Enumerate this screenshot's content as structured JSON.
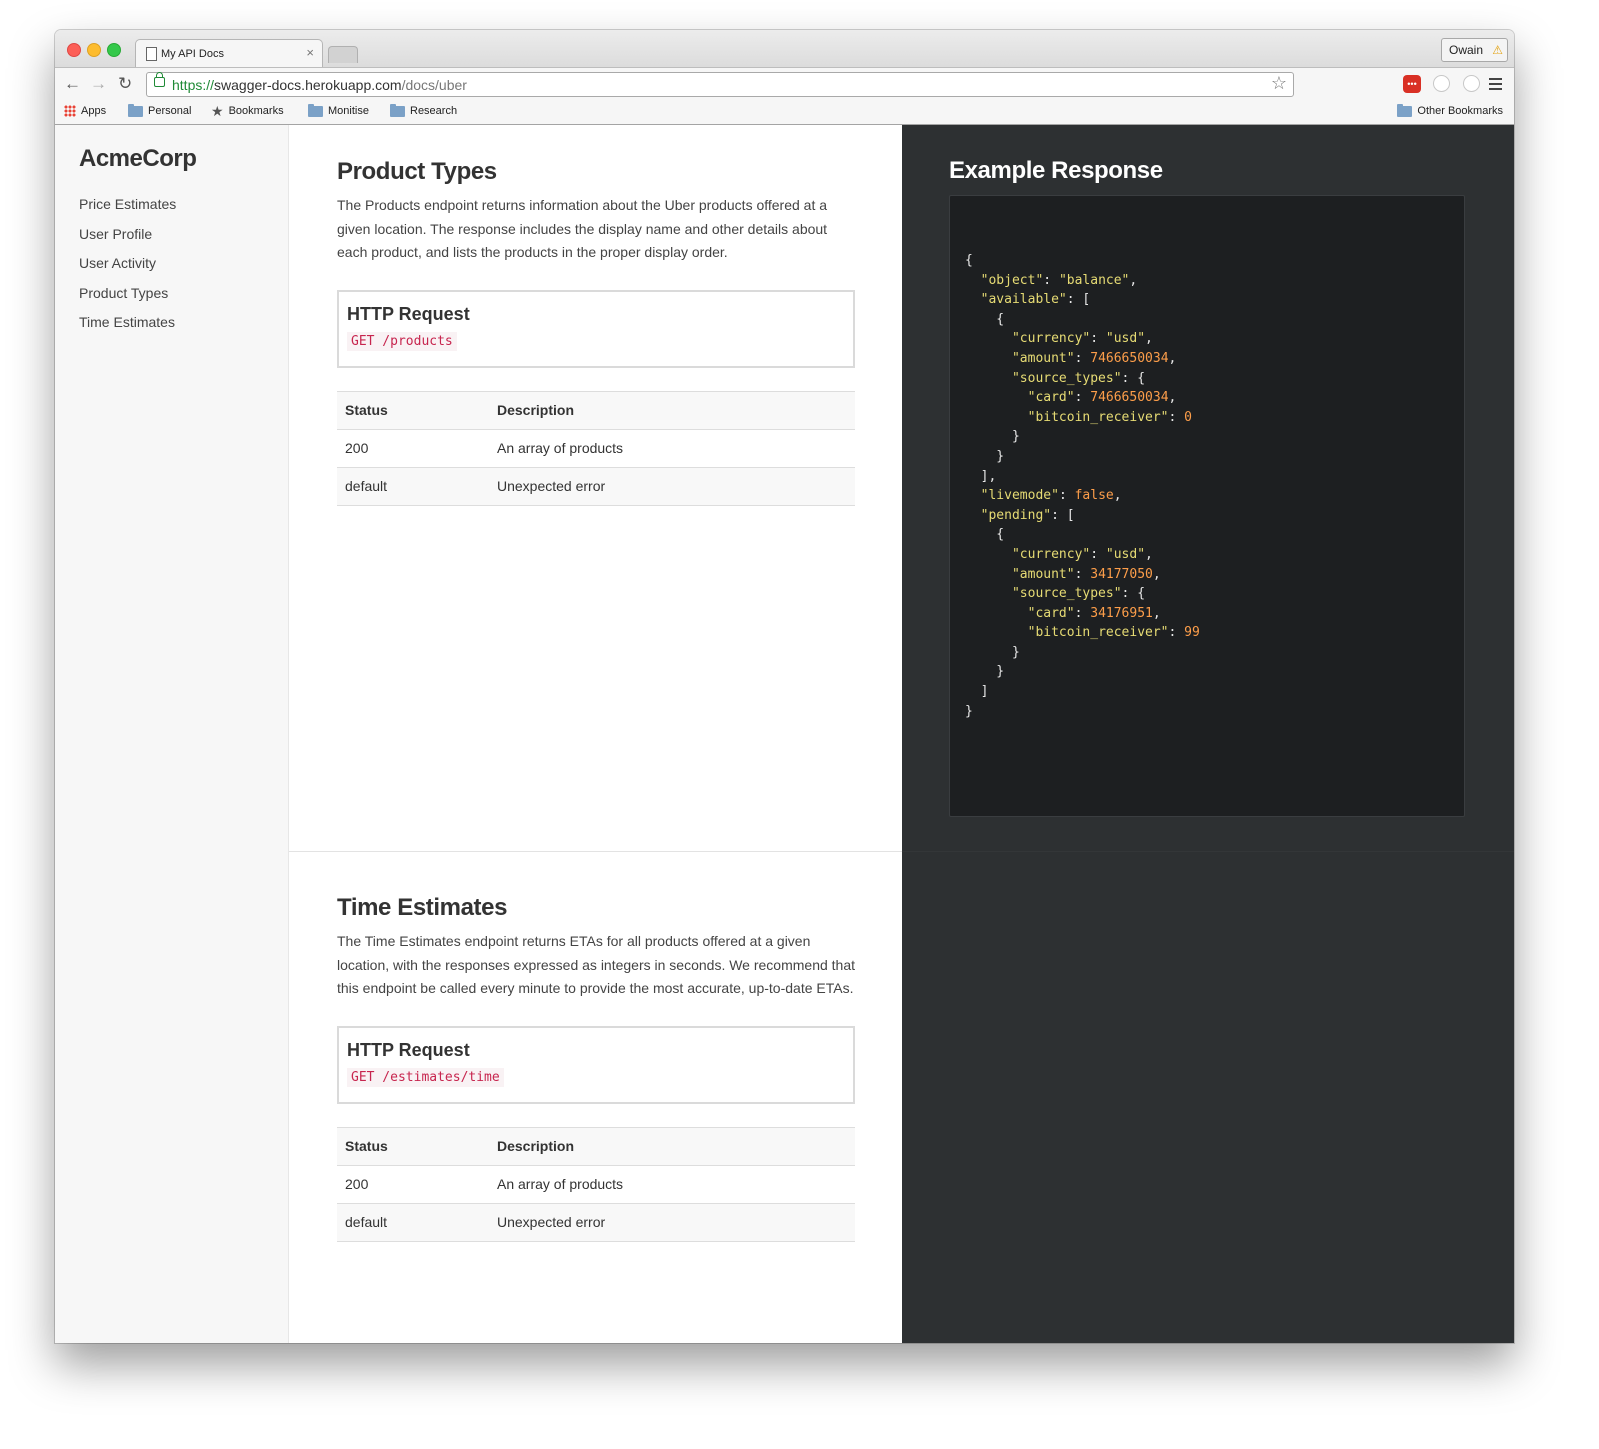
{
  "browser": {
    "tab_title": "My API Docs",
    "tab_close": "×",
    "user_name": "Owain",
    "url_scheme": "https://",
    "url_host": "swagger-docs.herokuapp.com",
    "url_path": "/docs/uber",
    "bookmarks": [
      "Apps",
      "Personal",
      "Bookmarks",
      "Monitise",
      "Research"
    ],
    "other_bookmarks": "Other Bookmarks"
  },
  "sidebar": {
    "brand": "AcmeCorp",
    "items": [
      {
        "label": "Price Estimates"
      },
      {
        "label": "User Profile"
      },
      {
        "label": "User Activity"
      },
      {
        "label": "Product Types"
      },
      {
        "label": "Time Estimates"
      }
    ]
  },
  "sections": [
    {
      "title": "Product Types",
      "description": "The Products endpoint returns information about the Uber products offered at a given location. The response includes the display name and other details about each product, and lists the products in the proper display order.",
      "request_title": "HTTP Request",
      "request_code": "GET /products",
      "table_headers": [
        "Status",
        "Description"
      ],
      "rows": [
        [
          "200",
          "An array of products"
        ],
        [
          "default",
          "Unexpected error"
        ]
      ]
    },
    {
      "title": "Time Estimates",
      "description": "The Time Estimates endpoint returns ETAs for all products offered at a given location, with the responses expressed as integers in seconds. We recommend that this endpoint be called every minute to provide the most accurate, up-to-date ETAs.",
      "request_title": "HTTP Request",
      "request_code": "GET /estimates/time",
      "table_headers": [
        "Status",
        "Description"
      ],
      "rows": [
        [
          "200",
          "An array of products"
        ],
        [
          "default",
          "Unexpected error"
        ]
      ]
    }
  ],
  "example": {
    "title": "Example Response",
    "json": "{\"object\":\"balance\",\"available\":[{\"currency\":\"usd\",\"amount\":7466650034,\"source_types\":{\"card\":7466650034,\"bitcoin_receiver\":0}}],\"livemode\":false,\"pending\":[{\"currency\":\"usd\",\"amount\":34177050,\"source_types\":{\"card\":34176951,\"bitcoin_receiver\":99}}]}"
  },
  "colors": {
    "dark_panel": "#2d3032",
    "code_bg": "#1d1f21",
    "code_key": "#e6db74",
    "code_number": "#fd9e4a",
    "request_code": "#c7254e"
  }
}
